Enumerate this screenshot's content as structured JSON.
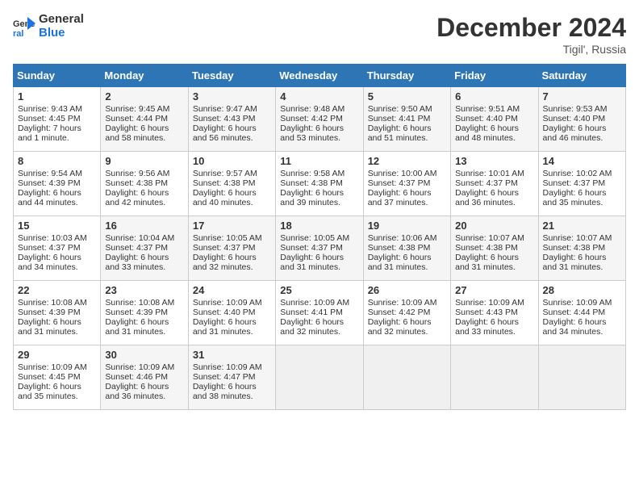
{
  "header": {
    "logo_line1": "General",
    "logo_line2": "Blue",
    "month": "December 2024",
    "location": "Tigil', Russia"
  },
  "weekdays": [
    "Sunday",
    "Monday",
    "Tuesday",
    "Wednesday",
    "Thursday",
    "Friday",
    "Saturday"
  ],
  "weeks": [
    [
      {
        "day": "1",
        "sunrise": "Sunrise: 9:43 AM",
        "sunset": "Sunset: 4:45 PM",
        "daylight": "Daylight: 7 hours and 1 minute."
      },
      {
        "day": "2",
        "sunrise": "Sunrise: 9:45 AM",
        "sunset": "Sunset: 4:44 PM",
        "daylight": "Daylight: 6 hours and 58 minutes."
      },
      {
        "day": "3",
        "sunrise": "Sunrise: 9:47 AM",
        "sunset": "Sunset: 4:43 PM",
        "daylight": "Daylight: 6 hours and 56 minutes."
      },
      {
        "day": "4",
        "sunrise": "Sunrise: 9:48 AM",
        "sunset": "Sunset: 4:42 PM",
        "daylight": "Daylight: 6 hours and 53 minutes."
      },
      {
        "day": "5",
        "sunrise": "Sunrise: 9:50 AM",
        "sunset": "Sunset: 4:41 PM",
        "daylight": "Daylight: 6 hours and 51 minutes."
      },
      {
        "day": "6",
        "sunrise": "Sunrise: 9:51 AM",
        "sunset": "Sunset: 4:40 PM",
        "daylight": "Daylight: 6 hours and 48 minutes."
      },
      {
        "day": "7",
        "sunrise": "Sunrise: 9:53 AM",
        "sunset": "Sunset: 4:40 PM",
        "daylight": "Daylight: 6 hours and 46 minutes."
      }
    ],
    [
      {
        "day": "8",
        "sunrise": "Sunrise: 9:54 AM",
        "sunset": "Sunset: 4:39 PM",
        "daylight": "Daylight: 6 hours and 44 minutes."
      },
      {
        "day": "9",
        "sunrise": "Sunrise: 9:56 AM",
        "sunset": "Sunset: 4:38 PM",
        "daylight": "Daylight: 6 hours and 42 minutes."
      },
      {
        "day": "10",
        "sunrise": "Sunrise: 9:57 AM",
        "sunset": "Sunset: 4:38 PM",
        "daylight": "Daylight: 6 hours and 40 minutes."
      },
      {
        "day": "11",
        "sunrise": "Sunrise: 9:58 AM",
        "sunset": "Sunset: 4:38 PM",
        "daylight": "Daylight: 6 hours and 39 minutes."
      },
      {
        "day": "12",
        "sunrise": "Sunrise: 10:00 AM",
        "sunset": "Sunset: 4:37 PM",
        "daylight": "Daylight: 6 hours and 37 minutes."
      },
      {
        "day": "13",
        "sunrise": "Sunrise: 10:01 AM",
        "sunset": "Sunset: 4:37 PM",
        "daylight": "Daylight: 6 hours and 36 minutes."
      },
      {
        "day": "14",
        "sunrise": "Sunrise: 10:02 AM",
        "sunset": "Sunset: 4:37 PM",
        "daylight": "Daylight: 6 hours and 35 minutes."
      }
    ],
    [
      {
        "day": "15",
        "sunrise": "Sunrise: 10:03 AM",
        "sunset": "Sunset: 4:37 PM",
        "daylight": "Daylight: 6 hours and 34 minutes."
      },
      {
        "day": "16",
        "sunrise": "Sunrise: 10:04 AM",
        "sunset": "Sunset: 4:37 PM",
        "daylight": "Daylight: 6 hours and 33 minutes."
      },
      {
        "day": "17",
        "sunrise": "Sunrise: 10:05 AM",
        "sunset": "Sunset: 4:37 PM",
        "daylight": "Daylight: 6 hours and 32 minutes."
      },
      {
        "day": "18",
        "sunrise": "Sunrise: 10:05 AM",
        "sunset": "Sunset: 4:37 PM",
        "daylight": "Daylight: 6 hours and 31 minutes."
      },
      {
        "day": "19",
        "sunrise": "Sunrise: 10:06 AM",
        "sunset": "Sunset: 4:38 PM",
        "daylight": "Daylight: 6 hours and 31 minutes."
      },
      {
        "day": "20",
        "sunrise": "Sunrise: 10:07 AM",
        "sunset": "Sunset: 4:38 PM",
        "daylight": "Daylight: 6 hours and 31 minutes."
      },
      {
        "day": "21",
        "sunrise": "Sunrise: 10:07 AM",
        "sunset": "Sunset: 4:38 PM",
        "daylight": "Daylight: 6 hours and 31 minutes."
      }
    ],
    [
      {
        "day": "22",
        "sunrise": "Sunrise: 10:08 AM",
        "sunset": "Sunset: 4:39 PM",
        "daylight": "Daylight: 6 hours and 31 minutes."
      },
      {
        "day": "23",
        "sunrise": "Sunrise: 10:08 AM",
        "sunset": "Sunset: 4:39 PM",
        "daylight": "Daylight: 6 hours and 31 minutes."
      },
      {
        "day": "24",
        "sunrise": "Sunrise: 10:09 AM",
        "sunset": "Sunset: 4:40 PM",
        "daylight": "Daylight: 6 hours and 31 minutes."
      },
      {
        "day": "25",
        "sunrise": "Sunrise: 10:09 AM",
        "sunset": "Sunset: 4:41 PM",
        "daylight": "Daylight: 6 hours and 32 minutes."
      },
      {
        "day": "26",
        "sunrise": "Sunrise: 10:09 AM",
        "sunset": "Sunset: 4:42 PM",
        "daylight": "Daylight: 6 hours and 32 minutes."
      },
      {
        "day": "27",
        "sunrise": "Sunrise: 10:09 AM",
        "sunset": "Sunset: 4:43 PM",
        "daylight": "Daylight: 6 hours and 33 minutes."
      },
      {
        "day": "28",
        "sunrise": "Sunrise: 10:09 AM",
        "sunset": "Sunset: 4:44 PM",
        "daylight": "Daylight: 6 hours and 34 minutes."
      }
    ],
    [
      {
        "day": "29",
        "sunrise": "Sunrise: 10:09 AM",
        "sunset": "Sunset: 4:45 PM",
        "daylight": "Daylight: 6 hours and 35 minutes."
      },
      {
        "day": "30",
        "sunrise": "Sunrise: 10:09 AM",
        "sunset": "Sunset: 4:46 PM",
        "daylight": "Daylight: 6 hours and 36 minutes."
      },
      {
        "day": "31",
        "sunrise": "Sunrise: 10:09 AM",
        "sunset": "Sunset: 4:47 PM",
        "daylight": "Daylight: 6 hours and 38 minutes."
      },
      null,
      null,
      null,
      null
    ]
  ]
}
